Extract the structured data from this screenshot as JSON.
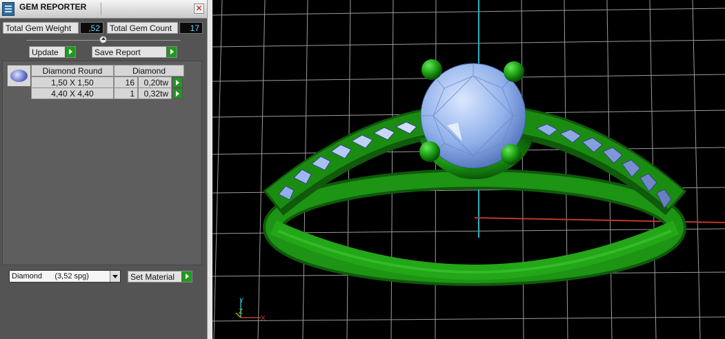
{
  "panel": {
    "title": "GEM REPORTER",
    "close_label": "✕",
    "icons": {
      "app": "gem-reporter-app-icon",
      "close": "close-icon",
      "go": "green-arrow-icon",
      "dropdown": "chevron-down-icon"
    },
    "total_weight_label": "Total Gem Weight",
    "total_weight_value": ",52",
    "total_count_label": "Total Gem Count",
    "total_count_value": "17",
    "update_label": "Update",
    "save_report_label": "Save Report",
    "table": {
      "headers": [
        "Diamond Round",
        "Diamond"
      ],
      "rows": [
        {
          "size": "1,50 X 1,50",
          "count": "16",
          "weight": "0,20tw"
        },
        {
          "size": "4,40 X 4,40",
          "count": "1",
          "weight": "0,32tw"
        }
      ]
    },
    "material_selected": "Diamond      (3,52 spg)",
    "set_material_label": "Set Material"
  },
  "viewport": {
    "axis_labels": {
      "y": "Y",
      "z": "Z",
      "x": "X"
    },
    "colors": {
      "metal": "#1a8a12",
      "gem": "#8fb0ea",
      "grid": "#b9b9b9",
      "axis_x": "#c0392b",
      "axis_y": "#27b3c2",
      "background": "#000000"
    }
  }
}
